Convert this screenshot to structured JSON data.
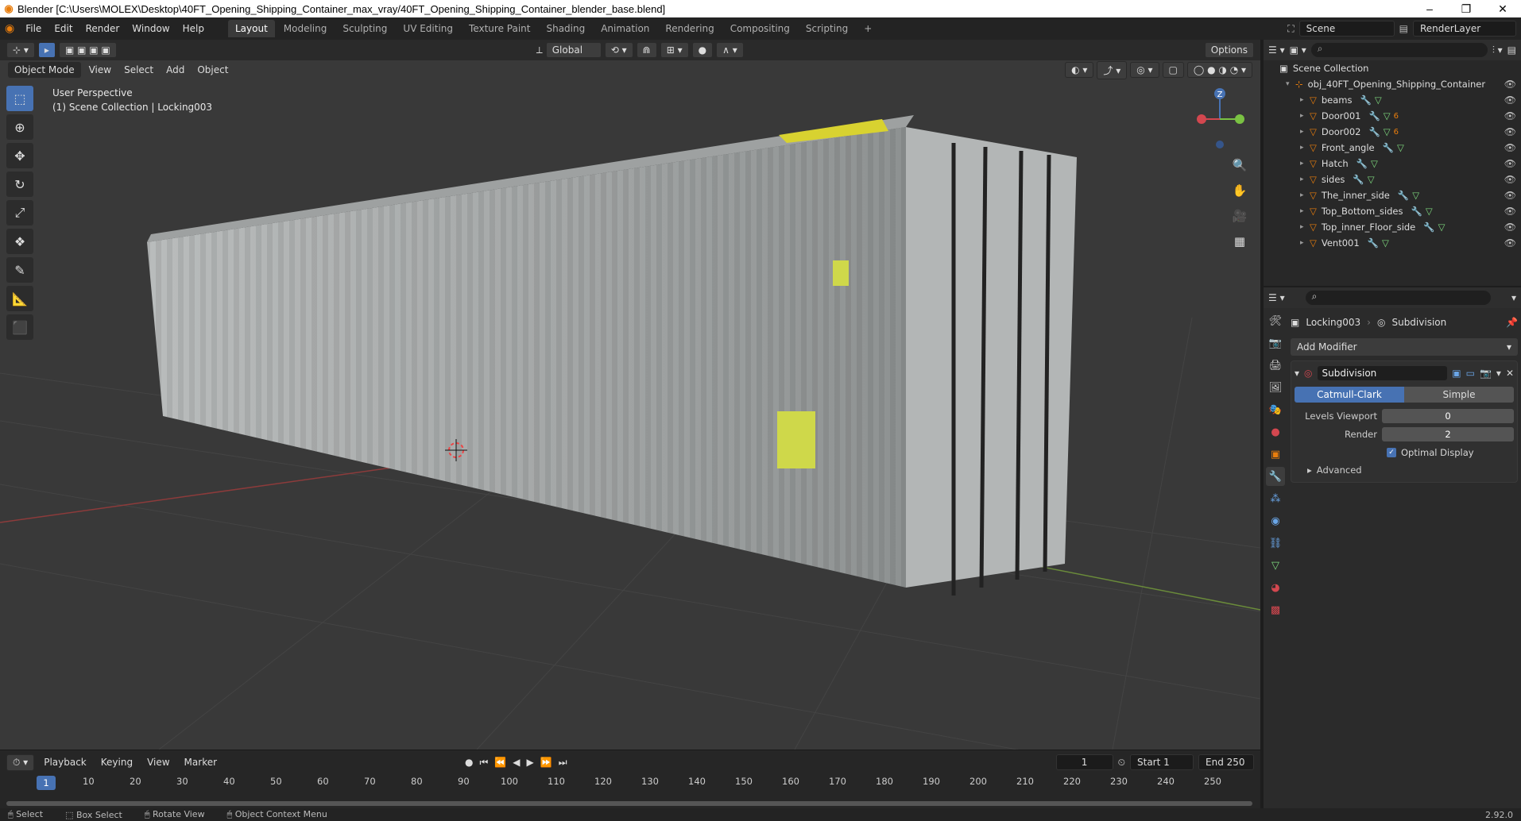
{
  "window": {
    "title": "Blender [C:\\Users\\MOLEX\\Desktop\\40FT_Opening_Shipping_Container_max_vray/40FT_Opening_Shipping_Container_blender_base.blend]",
    "minimize": "–",
    "maximize": "❐",
    "close": "✕"
  },
  "menubar": {
    "items": [
      "File",
      "Edit",
      "Render",
      "Window",
      "Help"
    ],
    "workspaces": [
      "Layout",
      "Modeling",
      "Sculpting",
      "UV Editing",
      "Texture Paint",
      "Shading",
      "Animation",
      "Rendering",
      "Compositing",
      "Scripting"
    ],
    "active_workspace": "Layout",
    "add_workspace": "+",
    "scene": "Scene",
    "render_layer": "RenderLayer"
  },
  "viewport": {
    "transform_orientation": "Global",
    "options": "Options",
    "mode": "Object Mode",
    "menus": [
      "View",
      "Select",
      "Add",
      "Object"
    ],
    "info_line1": "User Perspective",
    "info_line2": "(1) Scene Collection | Locking003",
    "gizmo_axis": "Z"
  },
  "outliner": {
    "root": "Scene Collection",
    "collection": "obj_40FT_Opening_Shipping_Container",
    "objects": [
      "beams",
      "Door001",
      "Door002",
      "Front_angle",
      "Hatch",
      "sides",
      "The_inner_side",
      "Top_Bottom_sides",
      "Top_inner_Floor_side",
      "Vent001"
    ],
    "badge_door001": "6",
    "badge_door002": "6"
  },
  "properties": {
    "object": "Locking003",
    "modifier_crumb": "Subdivision",
    "add_modifier": "Add Modifier",
    "modifier_name": "Subdivision",
    "type_options": [
      "Catmull-Clark",
      "Simple"
    ],
    "active_type": "Catmull-Clark",
    "levels_viewport_label": "Levels Viewport",
    "levels_viewport": "0",
    "render_label": "Render",
    "render": "2",
    "optimal_display": "Optimal Display",
    "advanced": "Advanced"
  },
  "timeline": {
    "menus": [
      "Playback",
      "Keying",
      "View",
      "Marker"
    ],
    "current_frame": "1",
    "start_label": "Start",
    "start": "1",
    "end_label": "End",
    "end": "250",
    "ruler": [
      "10",
      "20",
      "30",
      "40",
      "50",
      "60",
      "70",
      "80",
      "90",
      "100",
      "110",
      "120",
      "130",
      "140",
      "150",
      "160",
      "170",
      "180",
      "190",
      "200",
      "210",
      "220",
      "230",
      "240",
      "250"
    ]
  },
  "statusbar": {
    "select": "Select",
    "box_select": "Box Select",
    "rotate_view": "Rotate View",
    "context_menu": "Object Context Menu",
    "version": "2.92.0"
  },
  "colors": {
    "accent": "#4772b3",
    "object_icon": "#e87d0d",
    "mesh_icon": "#7ed97e",
    "modifier_icon": "#6aa6e8"
  }
}
